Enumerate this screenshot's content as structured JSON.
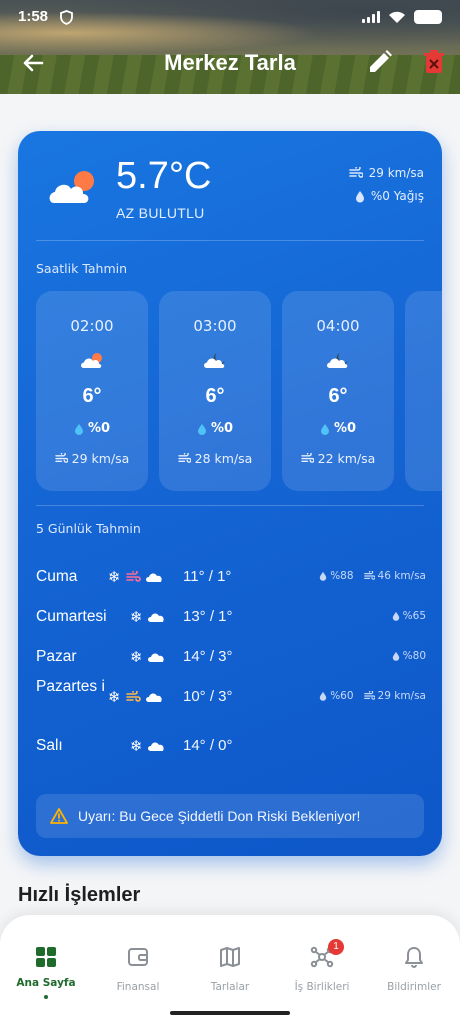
{
  "status_bar": {
    "time": "1:58"
  },
  "header": {
    "title": "Merkez Tarla"
  },
  "current": {
    "temperature": "5.7°C",
    "condition": "AZ BULUTLU",
    "wind": "29 km/sa",
    "rain": "%0 Yağış",
    "icon": "partly-cloudy-day-icon"
  },
  "hourly_label": "Saatlik Tahmin",
  "hourly": [
    {
      "time": "02:00",
      "icon": "partly-cloudy-day-icon",
      "temp": "6°",
      "rain": "%0",
      "wind": "29 km/sa"
    },
    {
      "time": "03:00",
      "icon": "partly-cloudy-night-icon",
      "temp": "6°",
      "rain": "%0",
      "wind": "28 km/sa"
    },
    {
      "time": "04:00",
      "icon": "partly-cloudy-night-icon",
      "temp": "6°",
      "rain": "%0",
      "wind": "22 km/sa"
    }
  ],
  "daily_label": "5 Günlük Tahmin",
  "daily": [
    {
      "day": "Cuma",
      "temp": "11° / 1°",
      "rain": "%88",
      "wind": "46 km/sa"
    },
    {
      "day": "Cumartesi",
      "temp": "13° / 1°",
      "rain": "%65"
    },
    {
      "day": "Pazar",
      "temp": "14° / 3°",
      "rain": "%80"
    },
    {
      "day": "Pazartes i",
      "temp": "10° / 3°",
      "rain": "%60",
      "wind": "29 km/sa"
    },
    {
      "day": "Salı",
      "temp": "14° / 0°"
    }
  ],
  "warning": "Uyarı: Bu Gece Şiddetli Don Riski Bekleniyor!",
  "quick_actions_title": "Hızlı İşlemler",
  "nav": {
    "items": [
      {
        "label": "Ana Sayfa",
        "icon": "grid-icon",
        "active": true
      },
      {
        "label": "Finansal",
        "icon": "wallet-icon"
      },
      {
        "label": "Tarlalar",
        "icon": "map-icon"
      },
      {
        "label": "İş Birlikleri",
        "icon": "network-icon",
        "badge": "1"
      },
      {
        "label": "Bildirimler",
        "icon": "bell-icon"
      }
    ]
  },
  "colors": {
    "card": "#1565d4",
    "accent_green": "#1e6b2c",
    "delete_red": "#e53935",
    "wind_pink": "#ff6b9a",
    "wind_orange": "#ffb74d"
  }
}
